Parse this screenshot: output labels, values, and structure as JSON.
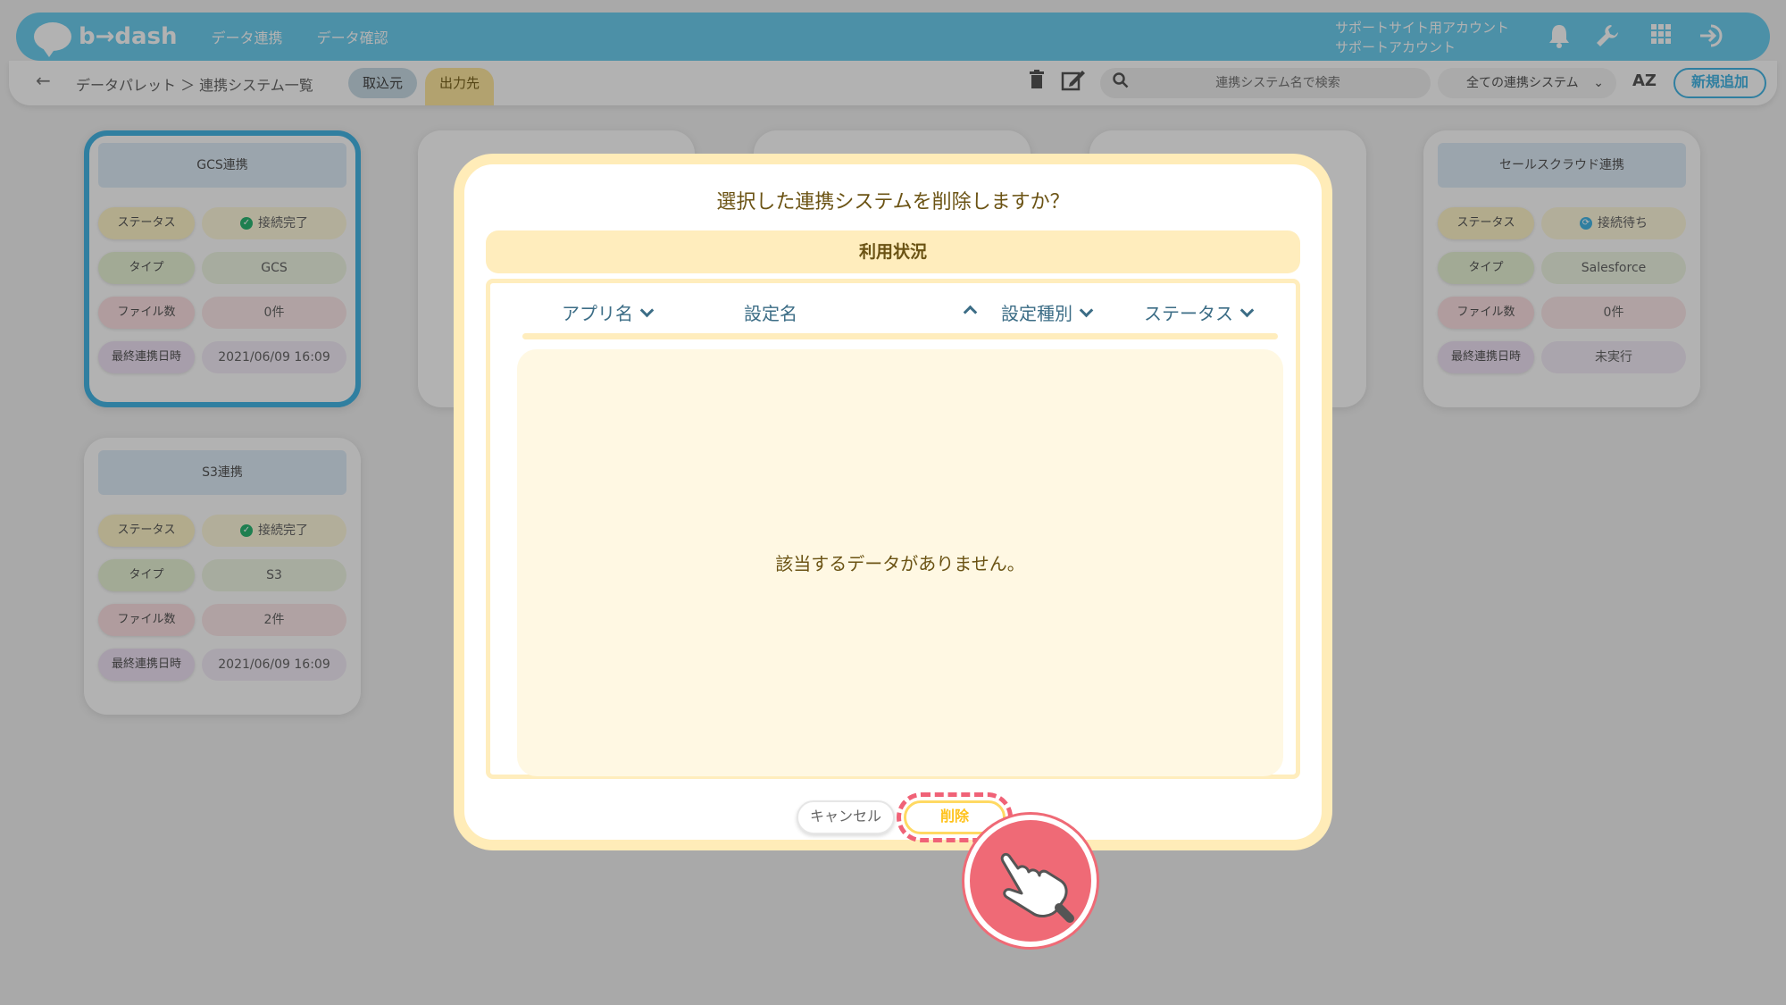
{
  "header": {
    "logo_text": "b→dash",
    "nav": [
      "データ連携",
      "データ確認"
    ],
    "account_line1": "サポートサイト用アカウント",
    "account_line2": "サポートアカウント",
    "icons": [
      "bell-icon",
      "wrench-icon",
      "apps-grid-icon",
      "logout-icon"
    ]
  },
  "toolbar": {
    "back_icon": "←",
    "breadcrumb": "データパレット ＞ 連携システム一覧",
    "tab_import": "取込元",
    "tab_export": "出力先",
    "search_placeholder": "連携システム名で検索",
    "filter_value": "全ての連携システム",
    "sort_label": "AZ",
    "add_button": "新規追加"
  },
  "labels": {
    "status": "ステータス",
    "type": "タイプ",
    "files": "ファイル数",
    "last": "最終連携日時"
  },
  "cards": [
    {
      "title": "GCS連携",
      "status": "接続完了",
      "type": "GCS",
      "files": "0件",
      "last": "2021/06/09 16:09"
    },
    {
      "title": "S3連携",
      "status": "接続完了",
      "type": "S3",
      "files": "2件",
      "last": "2021/06/09 16:09"
    },
    {
      "title": "セールスクラウド連携",
      "status": "接続待ち",
      "type": "Salesforce",
      "files": "0件",
      "last": "未実行"
    }
  ],
  "modal": {
    "title": "選択した連携システムを削除しますか？",
    "usage_label": "利用状況",
    "columns": [
      "アプリ名",
      "設定名",
      "設定種別",
      "ステータス"
    ],
    "empty_message": "該当するデータがありません。",
    "cancel_label": "キャンセル",
    "delete_label": "削除"
  },
  "colors": {
    "header": "#6ecff0",
    "accent": "#46b7e6",
    "modal_border": "#ffecb8",
    "highlight": "#f06277"
  }
}
